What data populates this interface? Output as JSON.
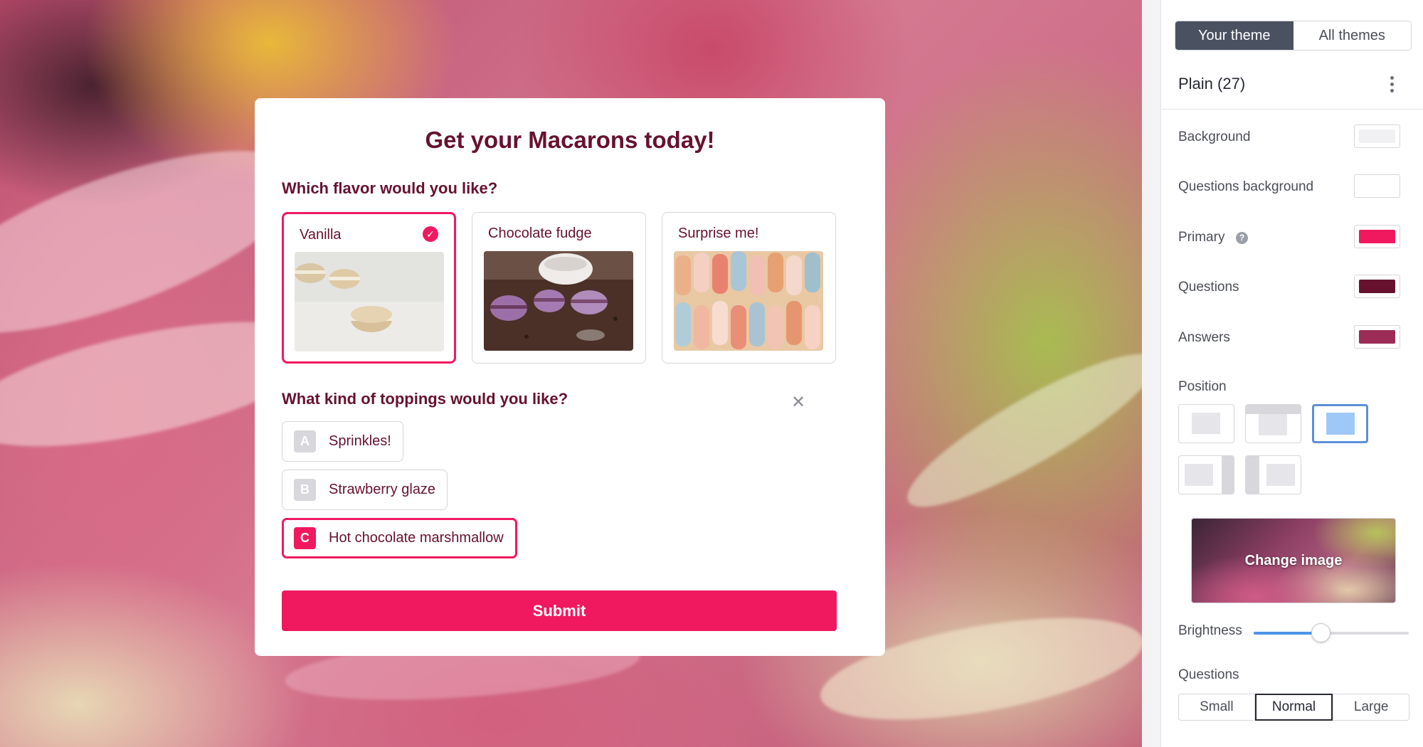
{
  "form": {
    "title": "Get your Macarons today!",
    "question1": {
      "label": "Which flavor would you like?",
      "choices": [
        {
          "label": "Vanilla",
          "selected": true
        },
        {
          "label": "Chocolate fudge",
          "selected": false
        },
        {
          "label": "Surprise me!",
          "selected": false
        }
      ]
    },
    "question2": {
      "label": "What kind of toppings would you like?",
      "options": [
        {
          "key": "A",
          "label": "Sprinkles!",
          "selected": false
        },
        {
          "key": "B",
          "label": "Strawberry glaze",
          "selected": false
        },
        {
          "key": "C",
          "label": "Hot chocolate marshmallow",
          "selected": true
        }
      ]
    },
    "close_symbol": "✕",
    "check_symbol": "✓",
    "submit_label": "Submit"
  },
  "panel": {
    "tabs": [
      {
        "label": "Your theme",
        "active": true
      },
      {
        "label": "All themes",
        "active": false
      }
    ],
    "theme_name": "Plain (27)",
    "colors": [
      {
        "label": "Background",
        "value": "#f1f1f3"
      },
      {
        "label": "Questions background",
        "value": "#ffffff"
      },
      {
        "label": "Primary",
        "value": "#f0195f"
      },
      {
        "label": "Questions",
        "value": "#66122e"
      },
      {
        "label": "Answers",
        "value": "#9b2c55"
      }
    ],
    "help_symbol": "?",
    "position_label": "Position",
    "position_options": [
      "full",
      "top",
      "center",
      "left",
      "right"
    ],
    "position_selected": "center",
    "change_image_label": "Change image",
    "brightness_label": "Brightness",
    "brightness_value": 0.43,
    "questions_size_label": "Questions",
    "sizes": [
      {
        "label": "Small",
        "active": false
      },
      {
        "label": "Normal",
        "active": true
      },
      {
        "label": "Large",
        "active": false
      }
    ]
  },
  "theme_colors": {
    "primary": "#f0195f",
    "text_dark": "#66122e",
    "tab_active": "#4a5160",
    "accent_blue": "#4f94e8"
  }
}
